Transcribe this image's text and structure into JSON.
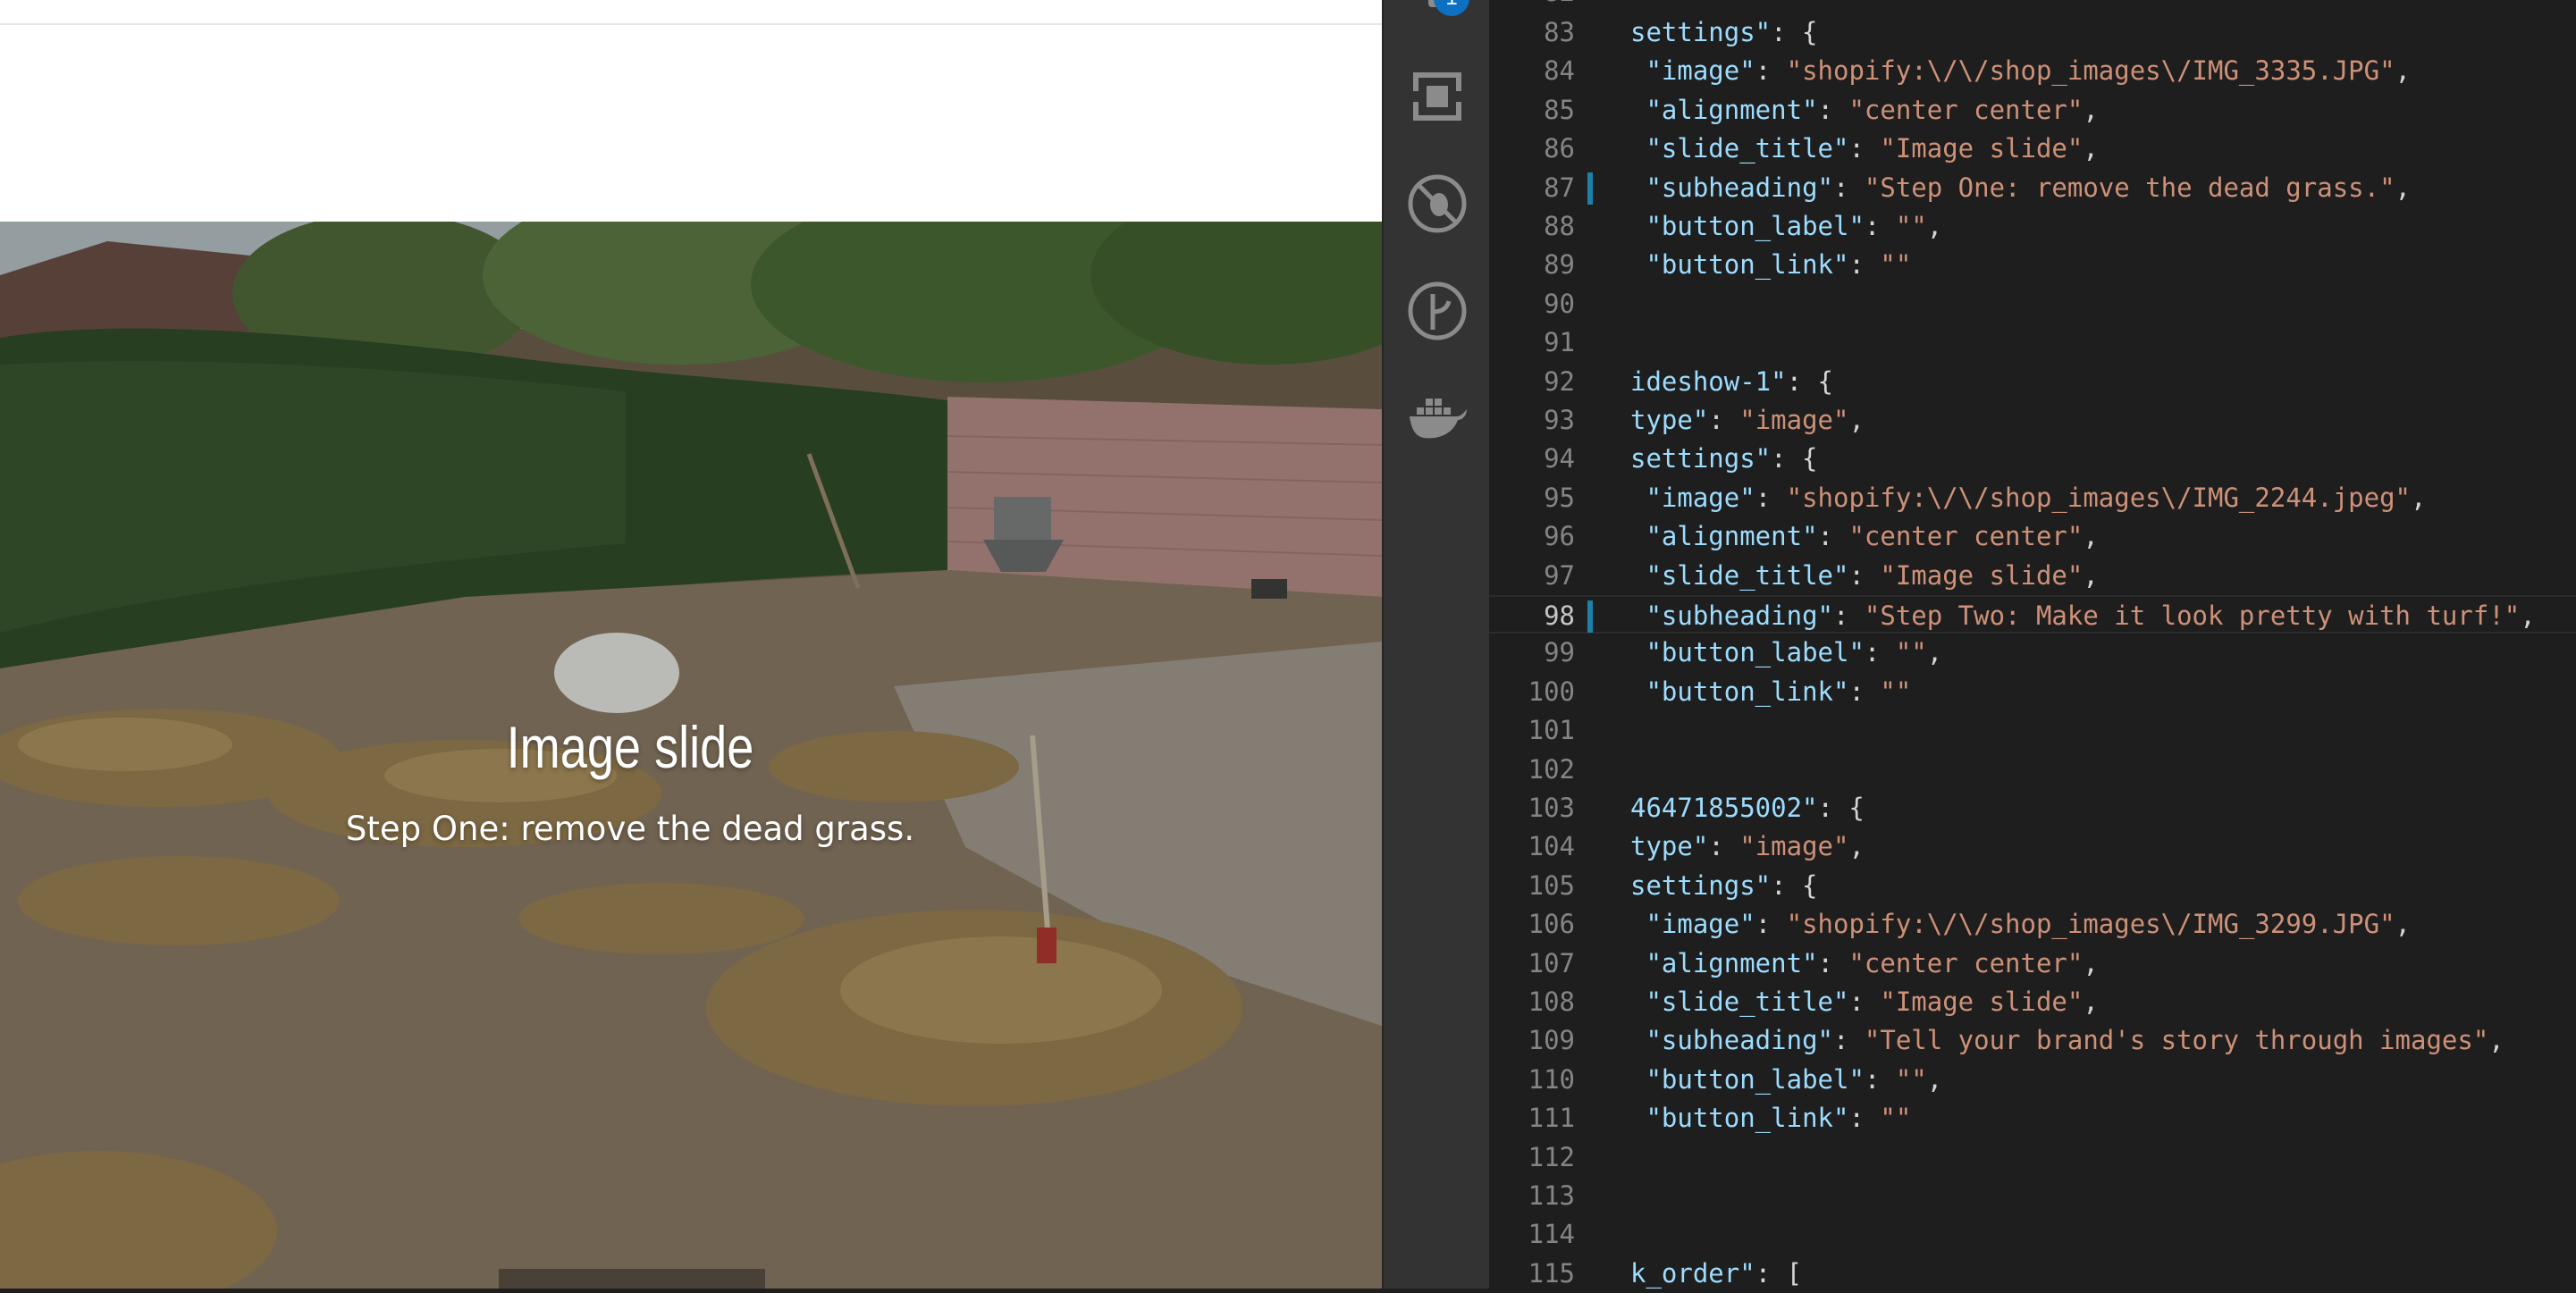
{
  "preview": {
    "slide_title": "Image slide",
    "slide_subheading": "Step One: remove the dead grass."
  },
  "activity_bar": {
    "badge_count": "1",
    "items": [
      {
        "name": "remote-explorer-icon"
      },
      {
        "name": "debug-icon"
      },
      {
        "name": "source-control-icon"
      },
      {
        "name": "docker-icon"
      }
    ]
  },
  "editor": {
    "lines": [
      {
        "n": "83",
        "t": [
          [
            "k",
            "settings\""
          ],
          [
            "p",
            ": {"
          ]
        ]
      },
      {
        "n": "84",
        "t": [
          [
            "p",
            " "
          ],
          [
            "k",
            "\"image\""
          ],
          [
            "p",
            ": "
          ],
          [
            "s",
            "\"shopify:\\/\\/shop_images\\/IMG_3335.JPG\""
          ],
          [
            "p",
            ","
          ]
        ]
      },
      {
        "n": "85",
        "t": [
          [
            "p",
            " "
          ],
          [
            "k",
            "\"alignment\""
          ],
          [
            "p",
            ": "
          ],
          [
            "s",
            "\"center center\""
          ],
          [
            "p",
            ","
          ]
        ]
      },
      {
        "n": "86",
        "t": [
          [
            "p",
            " "
          ],
          [
            "k",
            "\"slide_title\""
          ],
          [
            "p",
            ": "
          ],
          [
            "s",
            "\"Image slide\""
          ],
          [
            "p",
            ","
          ]
        ]
      },
      {
        "n": "87",
        "mark": true,
        "t": [
          [
            "p",
            " "
          ],
          [
            "k",
            "\"subheading\""
          ],
          [
            "p",
            ": "
          ],
          [
            "s",
            "\"Step One: remove the dead grass.\""
          ],
          [
            "p",
            ","
          ]
        ]
      },
      {
        "n": "88",
        "t": [
          [
            "p",
            " "
          ],
          [
            "k",
            "\"button_label\""
          ],
          [
            "p",
            ": "
          ],
          [
            "s",
            "\"\""
          ],
          [
            "p",
            ","
          ]
        ]
      },
      {
        "n": "89",
        "t": [
          [
            "p",
            " "
          ],
          [
            "k",
            "\"button_link\""
          ],
          [
            "p",
            ": "
          ],
          [
            "s",
            "\"\""
          ]
        ]
      },
      {
        "n": "90",
        "t": []
      },
      {
        "n": "91",
        "t": []
      },
      {
        "n": "92",
        "t": [
          [
            "k",
            "ideshow-1\""
          ],
          [
            "p",
            ": {"
          ]
        ]
      },
      {
        "n": "93",
        "t": [
          [
            "k",
            "type\""
          ],
          [
            "p",
            ": "
          ],
          [
            "s",
            "\"image\""
          ],
          [
            "p",
            ","
          ]
        ]
      },
      {
        "n": "94",
        "t": [
          [
            "k",
            "settings\""
          ],
          [
            "p",
            ": {"
          ]
        ]
      },
      {
        "n": "95",
        "t": [
          [
            "p",
            " "
          ],
          [
            "k",
            "\"image\""
          ],
          [
            "p",
            ": "
          ],
          [
            "s",
            "\"shopify:\\/\\/shop_images\\/IMG_2244.jpeg\""
          ],
          [
            "p",
            ","
          ]
        ]
      },
      {
        "n": "96",
        "t": [
          [
            "p",
            " "
          ],
          [
            "k",
            "\"alignment\""
          ],
          [
            "p",
            ": "
          ],
          [
            "s",
            "\"center center\""
          ],
          [
            "p",
            ","
          ]
        ]
      },
      {
        "n": "97",
        "t": [
          [
            "p",
            " "
          ],
          [
            "k",
            "\"slide_title\""
          ],
          [
            "p",
            ": "
          ],
          [
            "s",
            "\"Image slide\""
          ],
          [
            "p",
            ","
          ]
        ]
      },
      {
        "n": "98",
        "mark": true,
        "current": true,
        "t": [
          [
            "p",
            " "
          ],
          [
            "k",
            "\"subheading\""
          ],
          [
            "p",
            ": "
          ],
          [
            "s",
            "\"Step Two: Make it look pretty with turf!\""
          ],
          [
            "p",
            ","
          ]
        ]
      },
      {
        "n": "99",
        "t": [
          [
            "p",
            " "
          ],
          [
            "k",
            "\"button_label\""
          ],
          [
            "p",
            ": "
          ],
          [
            "s",
            "\"\""
          ],
          [
            "p",
            ","
          ]
        ]
      },
      {
        "n": "100",
        "t": [
          [
            "p",
            " "
          ],
          [
            "k",
            "\"button_link\""
          ],
          [
            "p",
            ": "
          ],
          [
            "s",
            "\"\""
          ]
        ]
      },
      {
        "n": "101",
        "t": []
      },
      {
        "n": "102",
        "t": []
      },
      {
        "n": "103",
        "t": [
          [
            "k",
            "46471855002\""
          ],
          [
            "p",
            ": {"
          ]
        ]
      },
      {
        "n": "104",
        "t": [
          [
            "k",
            "type\""
          ],
          [
            "p",
            ": "
          ],
          [
            "s",
            "\"image\""
          ],
          [
            "p",
            ","
          ]
        ]
      },
      {
        "n": "105",
        "t": [
          [
            "k",
            "settings\""
          ],
          [
            "p",
            ": {"
          ]
        ]
      },
      {
        "n": "106",
        "t": [
          [
            "p",
            " "
          ],
          [
            "k",
            "\"image\""
          ],
          [
            "p",
            ": "
          ],
          [
            "s",
            "\"shopify:\\/\\/shop_images\\/IMG_3299.JPG\""
          ],
          [
            "p",
            ","
          ]
        ]
      },
      {
        "n": "107",
        "t": [
          [
            "p",
            " "
          ],
          [
            "k",
            "\"alignment\""
          ],
          [
            "p",
            ": "
          ],
          [
            "s",
            "\"center center\""
          ],
          [
            "p",
            ","
          ]
        ]
      },
      {
        "n": "108",
        "t": [
          [
            "p",
            " "
          ],
          [
            "k",
            "\"slide_title\""
          ],
          [
            "p",
            ": "
          ],
          [
            "s",
            "\"Image slide\""
          ],
          [
            "p",
            ","
          ]
        ]
      },
      {
        "n": "109",
        "t": [
          [
            "p",
            " "
          ],
          [
            "k",
            "\"subheading\""
          ],
          [
            "p",
            ": "
          ],
          [
            "s",
            "\"Tell your brand's story through images\""
          ],
          [
            "p",
            ","
          ]
        ]
      },
      {
        "n": "110",
        "t": [
          [
            "p",
            " "
          ],
          [
            "k",
            "\"button_label\""
          ],
          [
            "p",
            ": "
          ],
          [
            "s",
            "\"\""
          ],
          [
            "p",
            ","
          ]
        ]
      },
      {
        "n": "111",
        "t": [
          [
            "p",
            " "
          ],
          [
            "k",
            "\"button_link\""
          ],
          [
            "p",
            ": "
          ],
          [
            "s",
            "\"\""
          ]
        ]
      },
      {
        "n": "112",
        "t": []
      },
      {
        "n": "113",
        "t": []
      },
      {
        "n": "114",
        "t": []
      },
      {
        "n": "115",
        "t": [
          [
            "k",
            "k_order\""
          ],
          [
            "p",
            ": ["
          ]
        ]
      }
    ]
  },
  "colors": {
    "editor_bg": "#1e1e1e",
    "activity_bg": "#333333",
    "key": "#9cdcfe",
    "string": "#ce9178",
    "line_number": "#858585",
    "modified_marker": "#1b81a8",
    "badge": "#0e70c0"
  }
}
